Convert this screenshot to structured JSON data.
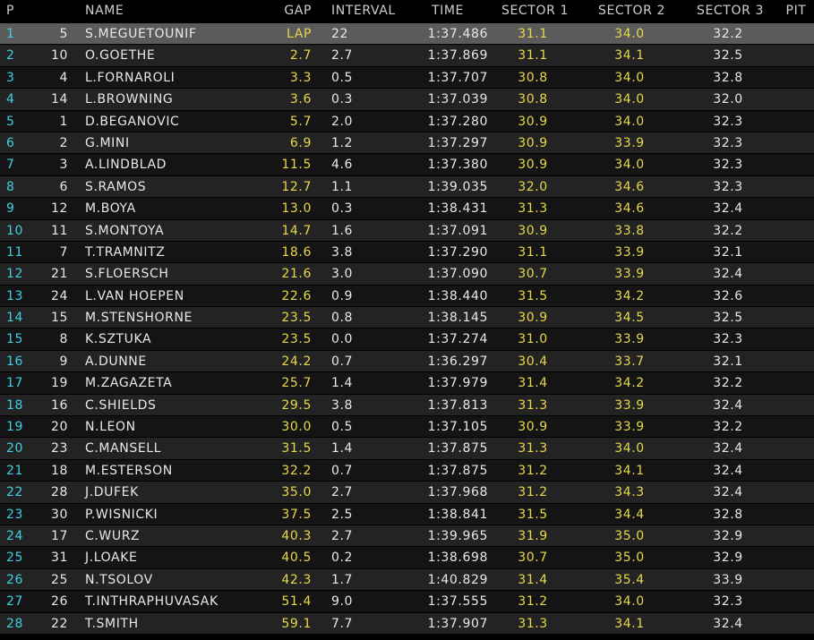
{
  "header": {
    "pos": "P",
    "num": "",
    "name": "NAME",
    "gap": "GAP",
    "interval": "INTERVAL",
    "time": "TIME",
    "sector1": "SECTOR 1",
    "sector2": "SECTOR 2",
    "sector3": "SECTOR 3",
    "pit": "PIT"
  },
  "rows": [
    {
      "pos": "1",
      "num": "5",
      "name": "S.MEGUETOUNIF",
      "gap": "LAP",
      "interval": "22",
      "time": "1:37.486",
      "s1": "31.1",
      "s2": "34.0",
      "s3": "32.2"
    },
    {
      "pos": "2",
      "num": "10",
      "name": "O.GOETHE",
      "gap": "2.7",
      "interval": "2.7",
      "time": "1:37.869",
      "s1": "31.1",
      "s2": "34.1",
      "s3": "32.5"
    },
    {
      "pos": "3",
      "num": "4",
      "name": "L.FORNAROLI",
      "gap": "3.3",
      "interval": "0.5",
      "time": "1:37.707",
      "s1": "30.8",
      "s2": "34.0",
      "s3": "32.8"
    },
    {
      "pos": "4",
      "num": "14",
      "name": "L.BROWNING",
      "gap": "3.6",
      "interval": "0.3",
      "time": "1:37.039",
      "s1": "30.8",
      "s2": "34.0",
      "s3": "32.0"
    },
    {
      "pos": "5",
      "num": "1",
      "name": "D.BEGANOVIC",
      "gap": "5.7",
      "interval": "2.0",
      "time": "1:37.280",
      "s1": "30.9",
      "s2": "34.0",
      "s3": "32.3"
    },
    {
      "pos": "6",
      "num": "2",
      "name": "G.MINI",
      "gap": "6.9",
      "interval": "1.2",
      "time": "1:37.297",
      "s1": "30.9",
      "s2": "33.9",
      "s3": "32.3"
    },
    {
      "pos": "7",
      "num": "3",
      "name": "A.LINDBLAD",
      "gap": "11.5",
      "interval": "4.6",
      "time": "1:37.380",
      "s1": "30.9",
      "s2": "34.0",
      "s3": "32.3"
    },
    {
      "pos": "8",
      "num": "6",
      "name": "S.RAMOS",
      "gap": "12.7",
      "interval": "1.1",
      "time": "1:39.035",
      "s1": "32.0",
      "s2": "34.6",
      "s3": "32.3"
    },
    {
      "pos": "9",
      "num": "12",
      "name": "M.BOYA",
      "gap": "13.0",
      "interval": "0.3",
      "time": "1:38.431",
      "s1": "31.3",
      "s2": "34.6",
      "s3": "32.4"
    },
    {
      "pos": "10",
      "num": "11",
      "name": "S.MONTOYA",
      "gap": "14.7",
      "interval": "1.6",
      "time": "1:37.091",
      "s1": "30.9",
      "s2": "33.8",
      "s3": "32.2"
    },
    {
      "pos": "11",
      "num": "7",
      "name": "T.TRAMNITZ",
      "gap": "18.6",
      "interval": "3.8",
      "time": "1:37.290",
      "s1": "31.1",
      "s2": "33.9",
      "s3": "32.1"
    },
    {
      "pos": "12",
      "num": "21",
      "name": "S.FLOERSCH",
      "gap": "21.6",
      "interval": "3.0",
      "time": "1:37.090",
      "s1": "30.7",
      "s2": "33.9",
      "s3": "32.4"
    },
    {
      "pos": "13",
      "num": "24",
      "name": "L.VAN HOEPEN",
      "gap": "22.6",
      "interval": "0.9",
      "time": "1:38.440",
      "s1": "31.5",
      "s2": "34.2",
      "s3": "32.6"
    },
    {
      "pos": "14",
      "num": "15",
      "name": "M.STENSHORNE",
      "gap": "23.5",
      "interval": "0.8",
      "time": "1:38.145",
      "s1": "30.9",
      "s2": "34.5",
      "s3": "32.5"
    },
    {
      "pos": "15",
      "num": "8",
      "name": "K.SZTUKA",
      "gap": "23.5",
      "interval": "0.0",
      "time": "1:37.274",
      "s1": "31.0",
      "s2": "33.9",
      "s3": "32.3"
    },
    {
      "pos": "16",
      "num": "9",
      "name": "A.DUNNE",
      "gap": "24.2",
      "interval": "0.7",
      "time": "1:36.297",
      "s1": "30.4",
      "s2": "33.7",
      "s3": "32.1"
    },
    {
      "pos": "17",
      "num": "19",
      "name": "M.ZAGAZETA",
      "gap": "25.7",
      "interval": "1.4",
      "time": "1:37.979",
      "s1": "31.4",
      "s2": "34.2",
      "s3": "32.2"
    },
    {
      "pos": "18",
      "num": "16",
      "name": "C.SHIELDS",
      "gap": "29.5",
      "interval": "3.8",
      "time": "1:37.813",
      "s1": "31.3",
      "s2": "33.9",
      "s3": "32.4"
    },
    {
      "pos": "19",
      "num": "20",
      "name": "N.LEON",
      "gap": "30.0",
      "interval": "0.5",
      "time": "1:37.105",
      "s1": "30.9",
      "s2": "33.9",
      "s3": "32.2"
    },
    {
      "pos": "20",
      "num": "23",
      "name": "C.MANSELL",
      "gap": "31.5",
      "interval": "1.4",
      "time": "1:37.875",
      "s1": "31.3",
      "s2": "34.0",
      "s3": "32.4"
    },
    {
      "pos": "21",
      "num": "18",
      "name": "M.ESTERSON",
      "gap": "32.2",
      "interval": "0.7",
      "time": "1:37.875",
      "s1": "31.2",
      "s2": "34.1",
      "s3": "32.4"
    },
    {
      "pos": "22",
      "num": "28",
      "name": "J.DUFEK",
      "gap": "35.0",
      "interval": "2.7",
      "time": "1:37.968",
      "s1": "31.2",
      "s2": "34.3",
      "s3": "32.4"
    },
    {
      "pos": "23",
      "num": "30",
      "name": "P.WISNICKI",
      "gap": "37.5",
      "interval": "2.5",
      "time": "1:38.841",
      "s1": "31.5",
      "s2": "34.4",
      "s3": "32.8"
    },
    {
      "pos": "24",
      "num": "17",
      "name": "C.WURZ",
      "gap": "40.3",
      "interval": "2.7",
      "time": "1:39.965",
      "s1": "31.9",
      "s2": "35.0",
      "s3": "32.9"
    },
    {
      "pos": "25",
      "num": "31",
      "name": "J.LOAKE",
      "gap": "40.5",
      "interval": "0.2",
      "time": "1:38.698",
      "s1": "30.7",
      "s2": "35.0",
      "s3": "32.9"
    },
    {
      "pos": "26",
      "num": "25",
      "name": "N.TSOLOV",
      "gap": "42.3",
      "interval": "1.7",
      "time": "1:40.829",
      "s1": "31.4",
      "s2": "35.4",
      "s3": "33.9"
    },
    {
      "pos": "27",
      "num": "26",
      "name": "T.INTHRAPHUVASAK",
      "gap": "51.4",
      "interval": "9.0",
      "time": "1:37.555",
      "s1": "31.2",
      "s2": "34.0",
      "s3": "32.3"
    },
    {
      "pos": "28",
      "num": "22",
      "name": "T.SMITH",
      "gap": "59.1",
      "interval": "7.7",
      "time": "1:37.907",
      "s1": "31.3",
      "s2": "34.1",
      "s3": "32.4"
    }
  ]
}
